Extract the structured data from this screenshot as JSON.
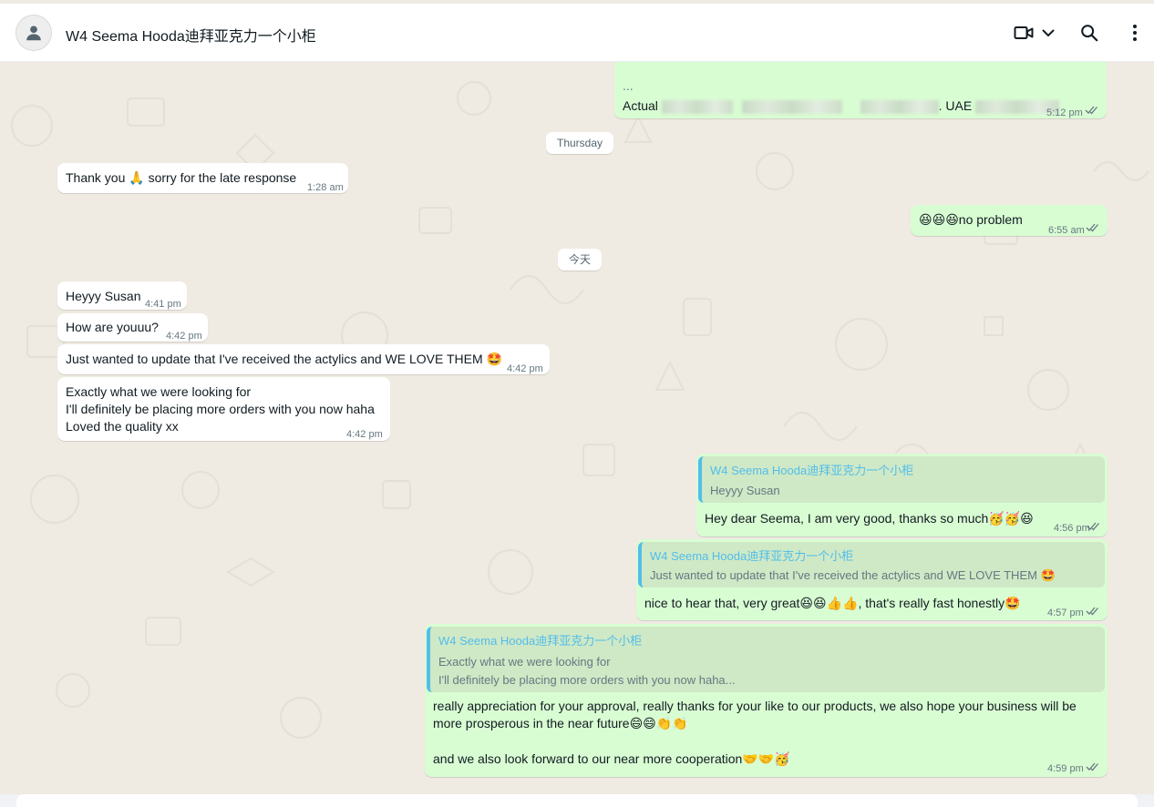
{
  "header": {
    "title": "W4 Seema Hooda迪拜亚克力一个小柜",
    "avatar_icon": "person-icon",
    "video_icon": "video-call-icon",
    "dropdown_icon": "chevron-down-icon",
    "search_icon": "search-icon",
    "menu_icon": "more-vertical-icon"
  },
  "messages": {
    "m0": {
      "text_cut": "...",
      "text_prefix": "Actual",
      "text_mid": ". UAE",
      "time": "5:12 pm"
    },
    "date1": "Thursday",
    "m1": {
      "text": "Thank you 🙏 sorry for the late response",
      "time": "1:28 am"
    },
    "m2": {
      "text": "😆😆😆no problem",
      "time": "6:55 am"
    },
    "date2": "今天",
    "m3": {
      "text": "Heyyy Susan",
      "time": "4:41 pm"
    },
    "m4": {
      "text": "How are youuu?",
      "time": "4:42 pm"
    },
    "m5": {
      "text": "Just wanted to update that I've received the actylics and WE LOVE THEM 🤩",
      "time": "4:42 pm"
    },
    "m6": {
      "line1": "Exactly what we were looking for",
      "line2": "I'll definitely be placing more orders with you now haha",
      "line3": "Loved the quality xx",
      "time": "4:42 pm"
    },
    "m7": {
      "quote_author": "W4 Seema Hooda迪拜亚克力一个小柜",
      "quote_text": "Heyyy Susan",
      "text": "Hey dear Seema, I am very good, thanks so much🥳🥳😆",
      "time": "4:56 pm"
    },
    "m8": {
      "quote_author": "W4 Seema Hooda迪拜亚克力一个小柜",
      "quote_text": "Just wanted to update that I've received the actylics and WE LOVE THEM 🤩",
      "text": "nice to hear that, very great😆😆👍👍, that's really fast honestly🤩",
      "time": "4:57 pm"
    },
    "m9": {
      "quote_author": "W4 Seema Hooda迪拜亚克力一个小柜",
      "quote_line1": "Exactly what we were looking for",
      "quote_line2": "I'll definitely be placing more orders with you now haha...",
      "line1": "really appreciation for your approval, really thanks for your like to our products, we also hope your business will be",
      "line2": "more prosperous in the near future😄😄👏👏",
      "line3": "and we also look forward to our near more cooperation🤝🤝🥳",
      "time": "4:59 pm"
    }
  },
  "colors": {
    "incoming": "#ffffff",
    "outgoing": "#d9fdd3",
    "read_ticks": "#667781",
    "quote_author": "#53bdeb",
    "background": "#efeae2"
  }
}
